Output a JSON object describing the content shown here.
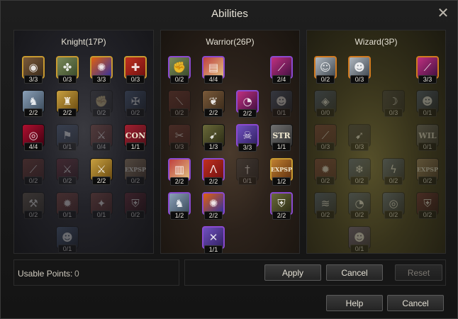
{
  "window": {
    "title": "Abilities",
    "close_icon": "close-icon"
  },
  "trees": {
    "knight": {
      "title": "Knight(17P)"
    },
    "warrior": {
      "title": "Warrior(26P)"
    },
    "wizard": {
      "title": "Wizard(3P)"
    }
  },
  "skills": {
    "k1": "3/3",
    "k2": "0/3",
    "k3": "3/3",
    "k4": "0/3",
    "k5": "2/2",
    "k6": "2/2",
    "k7": "0/2",
    "k8": "0/2",
    "k9": "4/4",
    "k10": "0/1",
    "k11": "0/4",
    "k12": "1/1",
    "k13": "0/2",
    "k14": "0/2",
    "k15": "2/2",
    "k16": "0/2",
    "k17": "0/2",
    "k18": "0/1",
    "k19": "0/1",
    "k20": "0/2",
    "k21": "0/1",
    "w1": "0/2",
    "w2": "4/4",
    "w3": "2/4",
    "w4": "0/2",
    "w5": "2/2",
    "w6": "2/2",
    "w7": "0/1",
    "w8": "0/3",
    "w9": "1/3",
    "w10": "3/3",
    "w11": "1/1",
    "w12": "2/2",
    "w13": "2/2",
    "w14": "0/1",
    "w15": "1/2",
    "w16": "1/2",
    "w17": "2/2",
    "w18": "2/2",
    "w19": "1/1",
    "z1": "0/2",
    "z2": "0/3",
    "z3": "3/3",
    "z4": "0/0",
    "z5": "0/3",
    "z6": "0/1",
    "z7": "0/3",
    "z8": "0/3",
    "z9": "0/1",
    "z10": "0/2",
    "z11": "0/2",
    "z12": "0/2",
    "z13": "0/2",
    "z14": "0/2",
    "z15": "0/2",
    "z16": "0/2",
    "z17": "0/2",
    "z18": "0/1"
  },
  "skill_text": {
    "con": "CON",
    "str": "STR",
    "exp": "EXP",
    "sp": "SP",
    "wil": "WIL"
  },
  "points": {
    "label": "Usable Points:",
    "value": "0"
  },
  "buttons": {
    "apply": "Apply",
    "cancel": "Cancel",
    "reset": "Reset",
    "help": "Help",
    "cancel_bottom": "Cancel"
  }
}
